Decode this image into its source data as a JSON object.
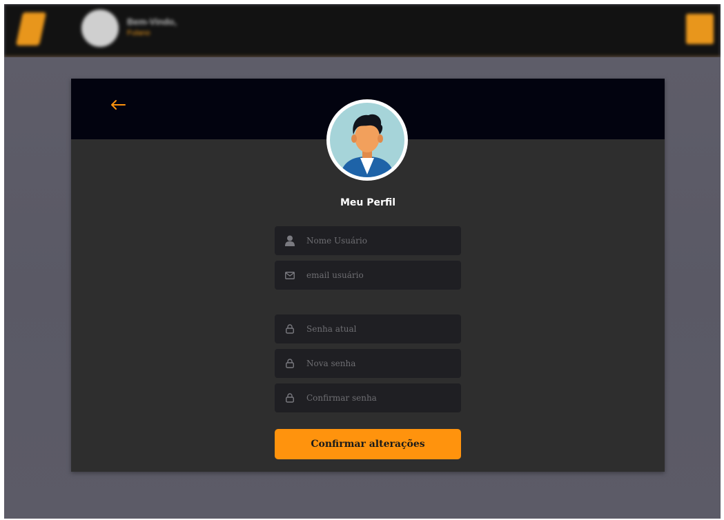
{
  "topbar": {
    "user_name": "Bem-Vindo,",
    "user_sub": "Fulano"
  },
  "profile": {
    "title": "Meu Perfil",
    "fields": {
      "username": {
        "placeholder": "Nome Usuário",
        "value": ""
      },
      "email": {
        "placeholder": "email usuário",
        "value": ""
      },
      "current_password": {
        "placeholder": "Senha atual",
        "value": ""
      },
      "new_password": {
        "placeholder": "Nova senha",
        "value": ""
      },
      "confirm_password": {
        "placeholder": "Confirmar senha",
        "value": ""
      }
    },
    "submit_label": "Confirmar alterações"
  },
  "icons": {
    "back": "arrow-left-icon",
    "username": "user-icon",
    "email": "envelope-icon",
    "password": "lock-icon"
  },
  "colors": {
    "accent": "#ff930d",
    "header_bg": "#02030f",
    "card_bg": "#2e2e2e",
    "field_bg": "#1f1f23",
    "backdrop": "#5b5a66"
  }
}
